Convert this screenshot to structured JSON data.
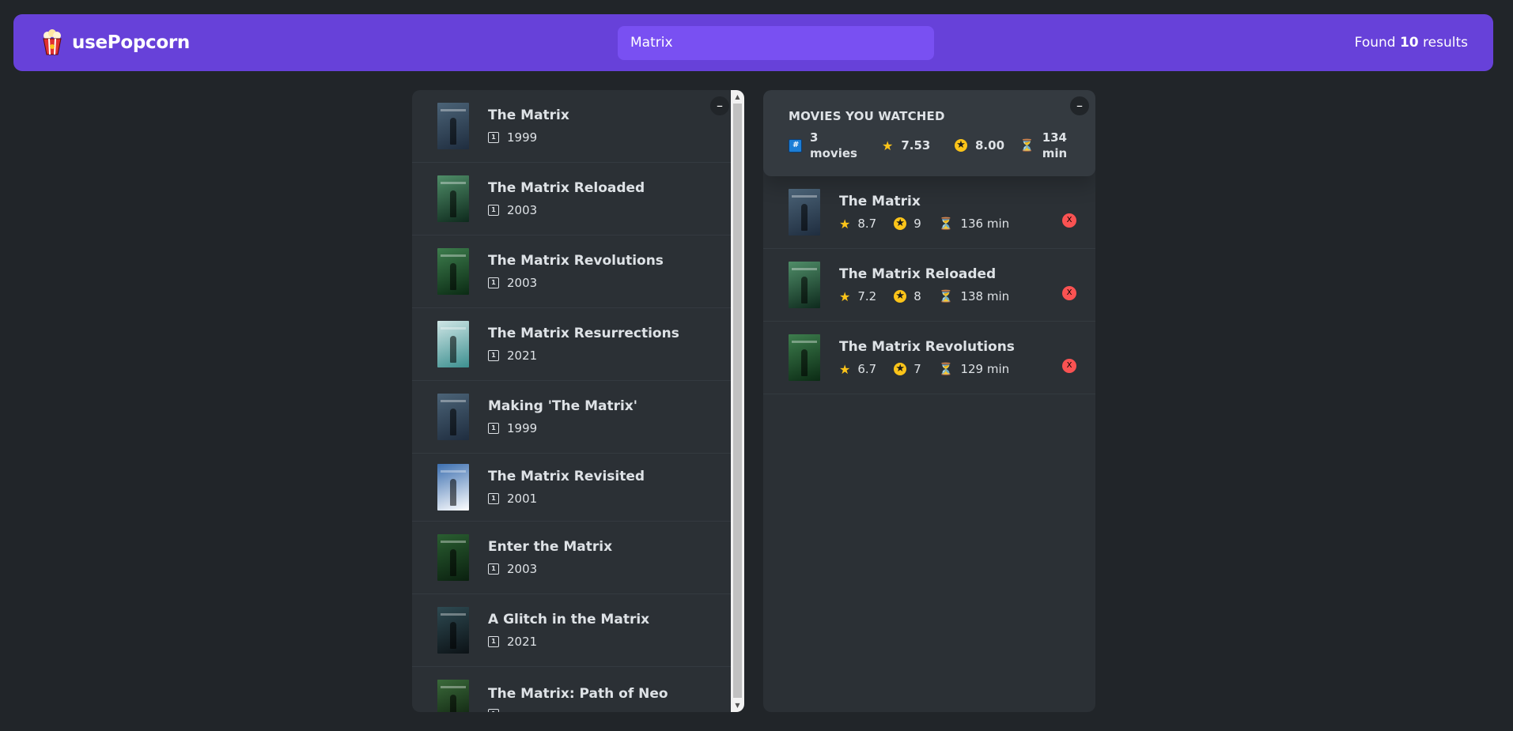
{
  "nav": {
    "logo_text": "usePopcorn",
    "search_value": "Matrix",
    "results_prefix": "Found",
    "results_count": "10",
    "results_suffix": "results"
  },
  "toggle_label": "–",
  "results": [
    {
      "title": "The Matrix",
      "year": "1999",
      "poster_colors": [
        "#1f2d3f",
        "#4b6377"
      ]
    },
    {
      "title": "The Matrix Reloaded",
      "year": "2003",
      "poster_colors": [
        "#0e2a1d",
        "#4f8d68"
      ]
    },
    {
      "title": "The Matrix Revolutions",
      "year": "2003",
      "poster_colors": [
        "#0b2b14",
        "#3d7d4d"
      ]
    },
    {
      "title": "The Matrix Resurrections",
      "year": "2021",
      "poster_colors": [
        "#3c8f8f",
        "#cfe6e6"
      ]
    },
    {
      "title": "Making 'The Matrix'",
      "year": "1999",
      "poster_colors": [
        "#1f2d3f",
        "#4b6377"
      ]
    },
    {
      "title": "The Matrix Revisited",
      "year": "2001",
      "poster_colors": [
        "#ffffff",
        "#3c6fb0"
      ]
    },
    {
      "title": "Enter the Matrix",
      "year": "2003",
      "poster_colors": [
        "#0a200f",
        "#2a5e31"
      ]
    },
    {
      "title": "A Glitch in the Matrix",
      "year": "2021",
      "poster_colors": [
        "#0c1216",
        "#2e4a52"
      ]
    },
    {
      "title": "The Matrix: Path of Neo",
      "year": "",
      "poster_colors": [
        "#0a1a0a",
        "#3a6a3a"
      ]
    }
  ],
  "summary": {
    "heading": "Movies you watched",
    "movies_count": "3",
    "movies_label": "movies",
    "avg_imdb": "7.53",
    "avg_user": "8.00",
    "avg_runtime": "134",
    "runtime_unit": "min"
  },
  "watched": [
    {
      "title": "The Matrix",
      "imdb": "8.7",
      "user": "9",
      "runtime": "136 min",
      "poster_colors": [
        "#1f2d3f",
        "#4b6377"
      ]
    },
    {
      "title": "The Matrix Reloaded",
      "imdb": "7.2",
      "user": "8",
      "runtime": "138 min",
      "poster_colors": [
        "#0e2a1d",
        "#4f8d68"
      ]
    },
    {
      "title": "The Matrix Revolutions",
      "imdb": "6.7",
      "user": "7",
      "runtime": "129 min",
      "poster_colors": [
        "#0b2b14",
        "#3d7d4d"
      ]
    }
  ],
  "delete_label": "X",
  "icons": {
    "logo": "popcorn-icon",
    "year": "calendar-icon",
    "count": "hash-icon",
    "imdb": "star-icon",
    "user": "star-dark-icon",
    "runtime": "hourglass-icon"
  },
  "colors": {
    "nav_bg": "#6741d9",
    "search_bg": "#7950f2",
    "page_bg": "#212529",
    "box_bg": "#2b3035",
    "summary_bg": "#343a40",
    "delete_bg": "#fa5252",
    "star": "#fcc419"
  }
}
